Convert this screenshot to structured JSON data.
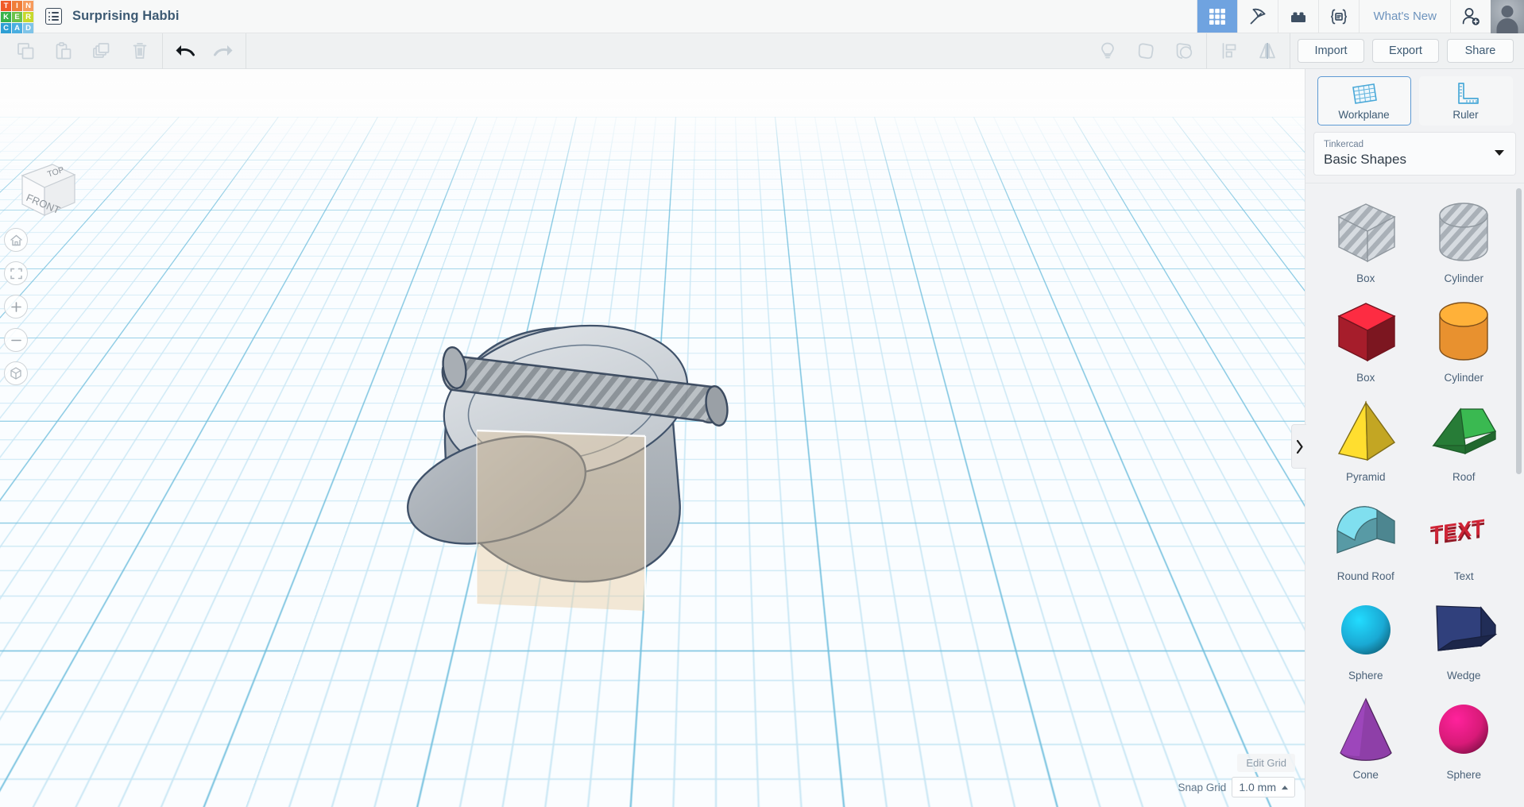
{
  "app": {
    "logo_letters": [
      "T",
      "I",
      "N",
      "K",
      "E",
      "R",
      "C",
      "A",
      "D"
    ],
    "logo_colors": [
      "#f05a28",
      "#ef7e3a",
      "#f79a5b",
      "#37b34a",
      "#6cc24a",
      "#c7d92b",
      "#2e9fd4",
      "#4aaee0",
      "#7fc4e8"
    ],
    "document_title": "Surprising Habbi",
    "menu_icon": "list-icon"
  },
  "header": {
    "tools": [
      {
        "name": "gallery-grid-icon",
        "label": "Gallery",
        "active": true
      },
      {
        "name": "pickaxe-icon",
        "label": "Minecraft",
        "active": false
      },
      {
        "name": "brick-icon",
        "label": "Blocks",
        "active": false
      },
      {
        "name": "codeblocks-icon",
        "label": "Codeblocks",
        "active": false
      }
    ],
    "whats_new_label": "What's New",
    "invite_icon": "add-user-icon",
    "avatar_label": "avatar",
    "active_color": "#6fa3e0"
  },
  "toolbar": {
    "left_icons": [
      {
        "name": "copy-icon",
        "label": "Copy",
        "enabled": false
      },
      {
        "name": "paste-icon",
        "label": "Paste",
        "enabled": false
      },
      {
        "name": "duplicate-icon",
        "label": "Duplicate",
        "enabled": false
      },
      {
        "name": "delete-icon",
        "label": "Delete",
        "enabled": false
      }
    ],
    "history_icons": [
      {
        "name": "undo-icon",
        "label": "Undo",
        "enabled": true
      },
      {
        "name": "redo-icon",
        "label": "Redo",
        "enabled": false
      }
    ],
    "right_icons": [
      {
        "name": "lightbulb-icon",
        "label": "Notes",
        "enabled": false
      },
      {
        "name": "group-icon",
        "label": "Group",
        "enabled": false
      },
      {
        "name": "ungroup-icon",
        "label": "Ungroup",
        "enabled": false
      },
      {
        "name": "align-icon",
        "label": "Align",
        "enabled": false
      },
      {
        "name": "mirror-icon",
        "label": "Mirror",
        "enabled": false
      }
    ],
    "buttons": [
      {
        "name": "import-button",
        "label": "Import"
      },
      {
        "name": "export-button",
        "label": "Export"
      },
      {
        "name": "share-button",
        "label": "Share"
      }
    ]
  },
  "viewport": {
    "viewcube": {
      "top_label": "TOP",
      "front_label": "FRONT"
    },
    "nav_buttons": [
      {
        "name": "home-view-button",
        "icon": "home-icon"
      },
      {
        "name": "fit-to-view-button",
        "icon": "fit-frame-icon"
      },
      {
        "name": "zoom-in-button",
        "icon": "plus-icon"
      },
      {
        "name": "zoom-out-button",
        "icon": "minus-icon"
      },
      {
        "name": "perspective-toggle-button",
        "icon": "cube-icon"
      }
    ],
    "grid": {
      "minor_color": "#c7e6f4",
      "major_color": "#6fbedd",
      "background": "#fafdff"
    },
    "objects": [
      {
        "name": "cylinder-hole",
        "type": "cylinder",
        "style": "hole-hatched",
        "orientation": "horizontal"
      },
      {
        "name": "rounded-body-solid",
        "type": "rounded-box",
        "style": "solid-gray"
      },
      {
        "name": "workplane-indicator",
        "type": "plane",
        "style": "translucent-tan",
        "color": "#f0dcc0"
      }
    ]
  },
  "grid_controls": {
    "edit_grid_label": "Edit Grid",
    "snap_grid_label": "Snap Grid",
    "snap_grid_value": "1.0 mm"
  },
  "right_panel": {
    "tools": [
      {
        "name": "workplane-tool",
        "label": "Workplane",
        "icon": "workplane-icon",
        "selected": true
      },
      {
        "name": "ruler-tool",
        "label": "Ruler",
        "icon": "ruler-icon",
        "selected": false
      }
    ],
    "library": {
      "provider": "Tinkercad",
      "collection": "Basic Shapes"
    },
    "shapes": [
      {
        "name": "shape-box-hole",
        "label": "Box",
        "kind": "box",
        "style": "hole",
        "color": "#c5ccd2"
      },
      {
        "name": "shape-cylinder-hole",
        "label": "Cylinder",
        "kind": "cylinder",
        "style": "hole",
        "color": "#c5ccd2"
      },
      {
        "name": "shape-box-red",
        "label": "Box",
        "kind": "box",
        "style": "solid",
        "color": "#cf2436"
      },
      {
        "name": "shape-cylinder-orange",
        "label": "Cylinder",
        "kind": "cylinder",
        "style": "solid",
        "color": "#e8912f"
      },
      {
        "name": "shape-pyramid",
        "label": "Pyramid",
        "kind": "pyramid",
        "style": "solid",
        "color": "#e8c62a"
      },
      {
        "name": "shape-roof",
        "label": "Roof",
        "kind": "roof",
        "style": "solid",
        "color": "#35a84a"
      },
      {
        "name": "shape-round-roof",
        "label": "Round Roof",
        "kind": "roundroof",
        "style": "solid",
        "color": "#6ec0ce"
      },
      {
        "name": "shape-text",
        "label": "Text",
        "kind": "text",
        "style": "solid",
        "color": "#cf2436"
      },
      {
        "name": "shape-sphere",
        "label": "Sphere",
        "kind": "sphere",
        "style": "solid",
        "color": "#1aa9d4"
      },
      {
        "name": "shape-wedge",
        "label": "Wedge",
        "kind": "wedge",
        "style": "solid",
        "color": "#2c3b73"
      },
      {
        "name": "shape-cone",
        "label": "Cone",
        "kind": "cone",
        "style": "solid",
        "color": "#8e3fa8"
      },
      {
        "name": "shape-sphere-magenta",
        "label": "Sphere",
        "kind": "sphere",
        "style": "solid",
        "color": "#d81a78"
      }
    ],
    "collapse_handle": "chevron-right-icon"
  }
}
